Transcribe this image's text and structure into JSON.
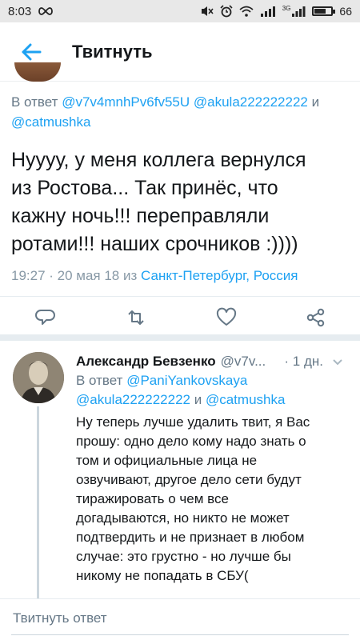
{
  "status_bar": {
    "time": "8:03",
    "battery": "66",
    "battery_level": 0.66,
    "network_label": "3G"
  },
  "app_bar": {
    "title": "Твитнуть"
  },
  "main_tweet": {
    "reply_prefix": "В ответ",
    "reply_handle_1": "@v7v4mnhPv6fv55U",
    "reply_handle_2": "@akula222222222",
    "reply_and": "и",
    "reply_handle_3": "@catmushka",
    "text_1": "Нуууу, у меня коллега вернулся",
    "text_2": "из Ростова... Так принёс, что",
    "text_3": "кажну ночь!!! переправляли",
    "text_4": "ротами!!! наших срочников :))))",
    "time": "19:27 · 20 мая 18",
    "from": "из",
    "location": "Санкт-Петербург, Россия"
  },
  "actions": [
    "reply-icon",
    "retweet-icon",
    "like-icon",
    "share-icon"
  ],
  "reply_tweet": {
    "name": "Александр Бевзенко",
    "handle": "@v7v...",
    "time": "· 1 дн.",
    "reply_prefix": "В ответ",
    "reply_handle_1": "@PaniYankovskaya",
    "reply_handle_2": "@akula222222222",
    "reply_and": "и",
    "reply_handle_3": "@catmushka",
    "lines": [
      "Ну теперь лучше удалить твит, я Вас",
      "прошу: одно дело кому надо знать о",
      "том и официальные лица не",
      "озвучивают, другое дело сети будут",
      "тиражировать о чем все",
      "догадываются, но никто не может",
      "подтвердить и не признает в любом",
      "случае: это грустно - но лучше бы",
      "никому не попадать в СБУ("
    ]
  },
  "compose": {
    "placeholder": "Твитнуть ответ"
  },
  "colors": {
    "accent": "#1da1f2",
    "muted": "#657786",
    "text": "#14171a"
  }
}
